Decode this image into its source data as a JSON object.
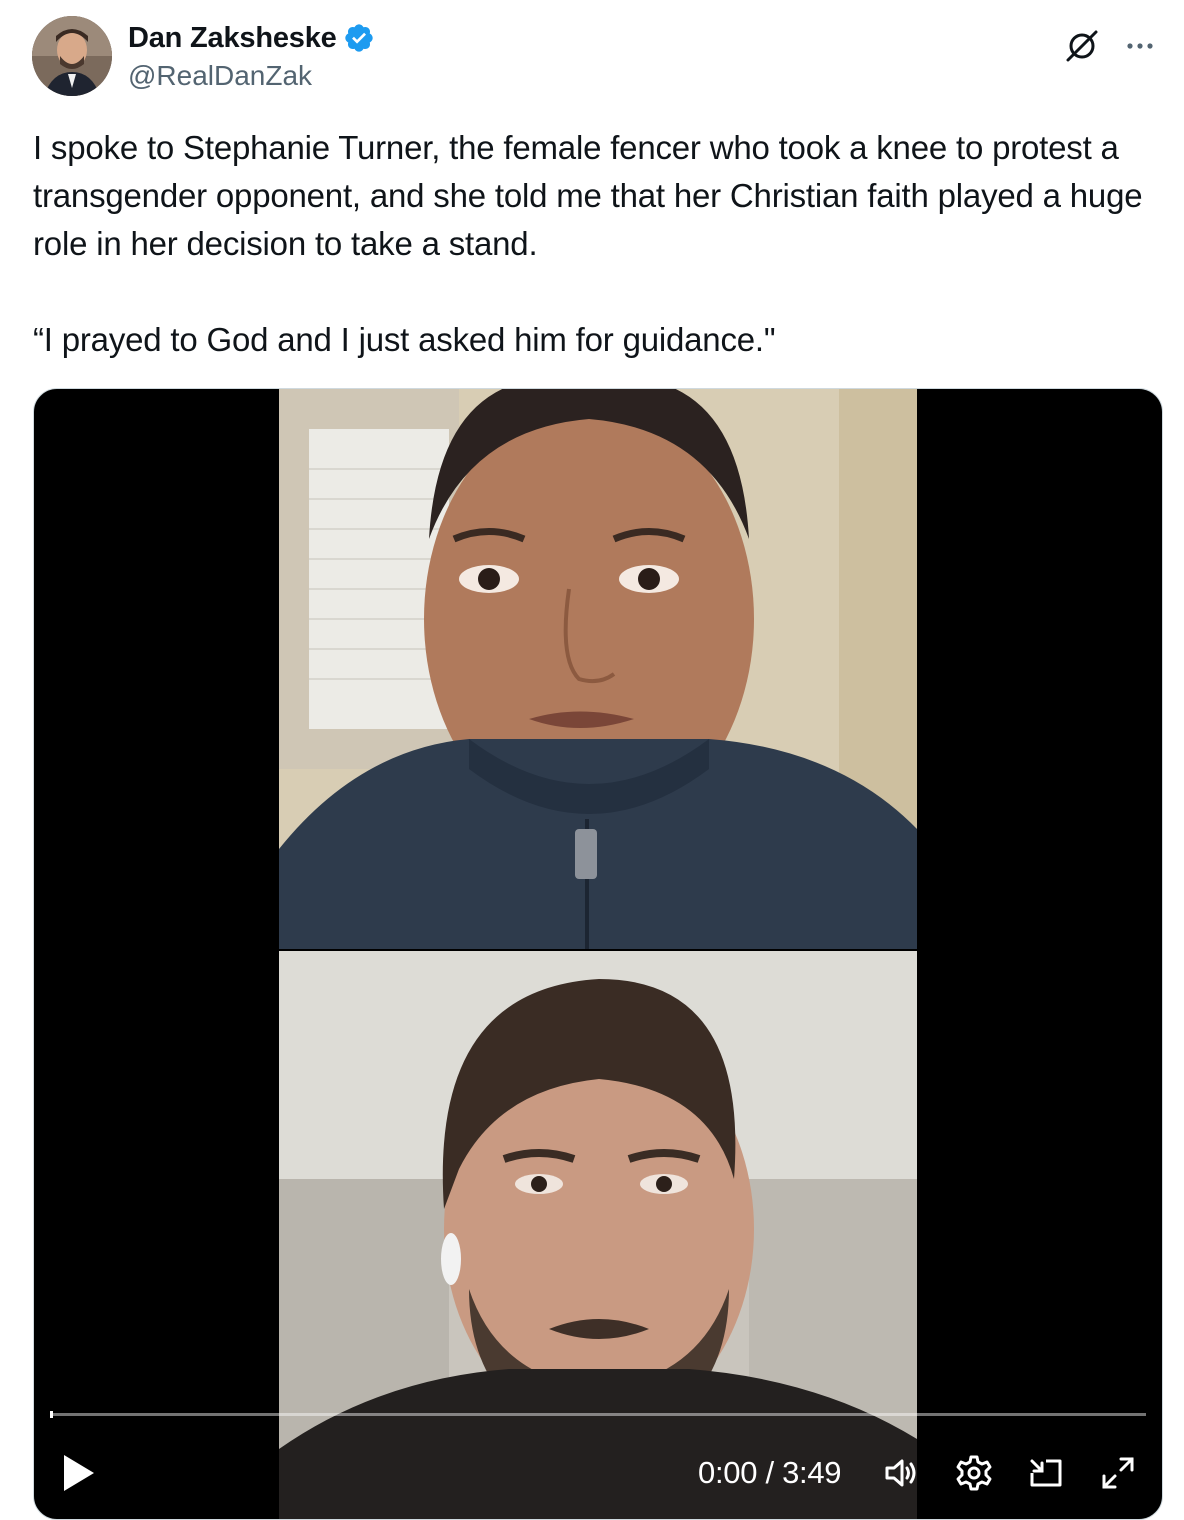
{
  "author": {
    "display_name": "Dan Zaksheske",
    "handle": "@RealDanZak",
    "verified_icon": "verified-badge-icon"
  },
  "header_actions": {
    "grok_icon": "grok-icon",
    "more_icon": "more-icon"
  },
  "tweet": {
    "text": "I spoke to Stephanie Turner, the female fencer who took a knee to protest a transgender opponent, and she told me that her Christian faith played a huge role in her decision to take a stand.\n\n“I prayed to God and I just asked him for guidance.\""
  },
  "video": {
    "time_display": "0:00 / 3:49",
    "progress": 0,
    "controls": [
      "play-icon",
      "volume-icon",
      "settings-icon",
      "pip-icon",
      "fullscreen-icon"
    ]
  },
  "colors": {
    "accent": "#1d9bf0",
    "text": "#0f1419",
    "secondary": "#536471",
    "border": "#cfd9de"
  }
}
